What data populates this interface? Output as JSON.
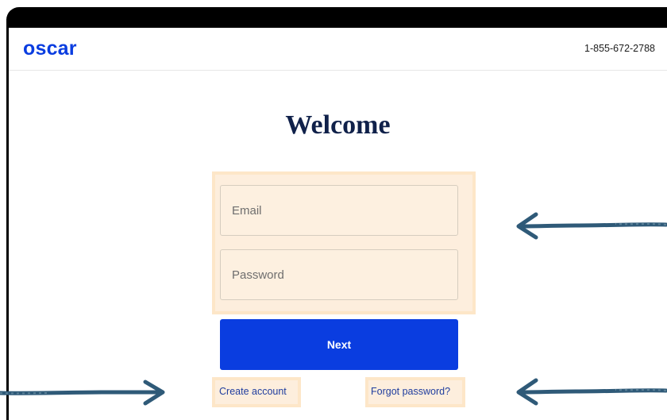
{
  "header": {
    "logo_text": "oscar",
    "phone": "1-855-672-2788"
  },
  "main": {
    "title": "Welcome",
    "email_placeholder": "Email",
    "password_placeholder": "Password",
    "next_label": "Next",
    "create_account_label": "Create account",
    "forgot_password_label": "Forgot password?"
  },
  "colors": {
    "brand": "#0a3de0",
    "title": "#10214a",
    "highlight": "#fdeedd",
    "arrow": "#2f5a78"
  },
  "annotations": [
    {
      "icon": "arrow-left-icon",
      "target": "credentials-fields"
    },
    {
      "icon": "arrow-right-icon",
      "target": "create-account-link"
    },
    {
      "icon": "arrow-left-icon",
      "target": "forgot-password-link"
    }
  ]
}
